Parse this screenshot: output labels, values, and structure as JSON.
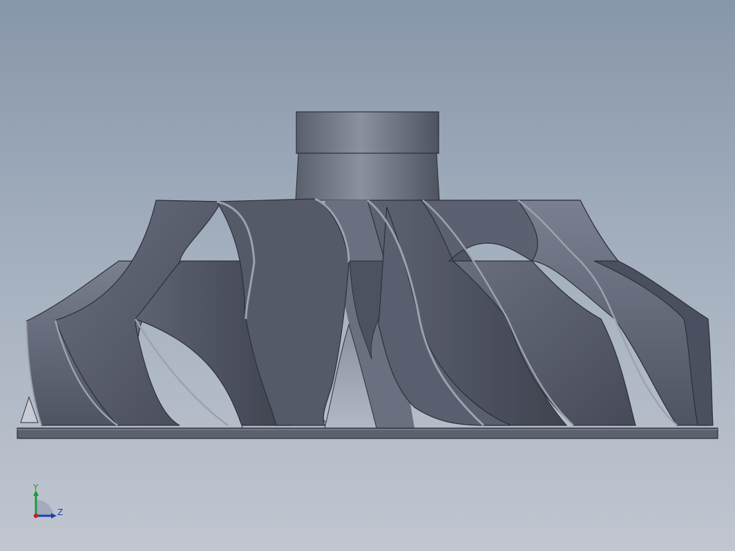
{
  "viewport": {
    "background_top": "#8796a9",
    "background_bottom": "#c1c6d0"
  },
  "model": {
    "part": "impeller",
    "body_color": "#5c6272",
    "edge_color": "#2c2f38"
  },
  "triad": {
    "y_label": "Y",
    "z_label": "Z",
    "y_axis_color": "#1e9a3a",
    "z_axis_color": "#1f3fb0",
    "origin_color": "#c0202a"
  }
}
